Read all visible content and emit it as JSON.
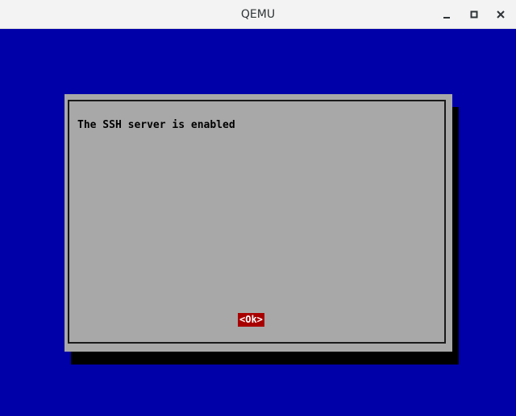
{
  "window": {
    "title": "QEMU",
    "controls": [
      "minimize-icon",
      "maximize-icon",
      "close-icon"
    ]
  },
  "dialog": {
    "message": "The SSH server is enabled",
    "ok_label": "<Ok>"
  },
  "colors": {
    "screen_background": "#0000a8",
    "dialog_background": "#a8a8a8",
    "dialog_shadow": "#000000",
    "button_background": "#a80000",
    "button_text": "#ffffff"
  }
}
